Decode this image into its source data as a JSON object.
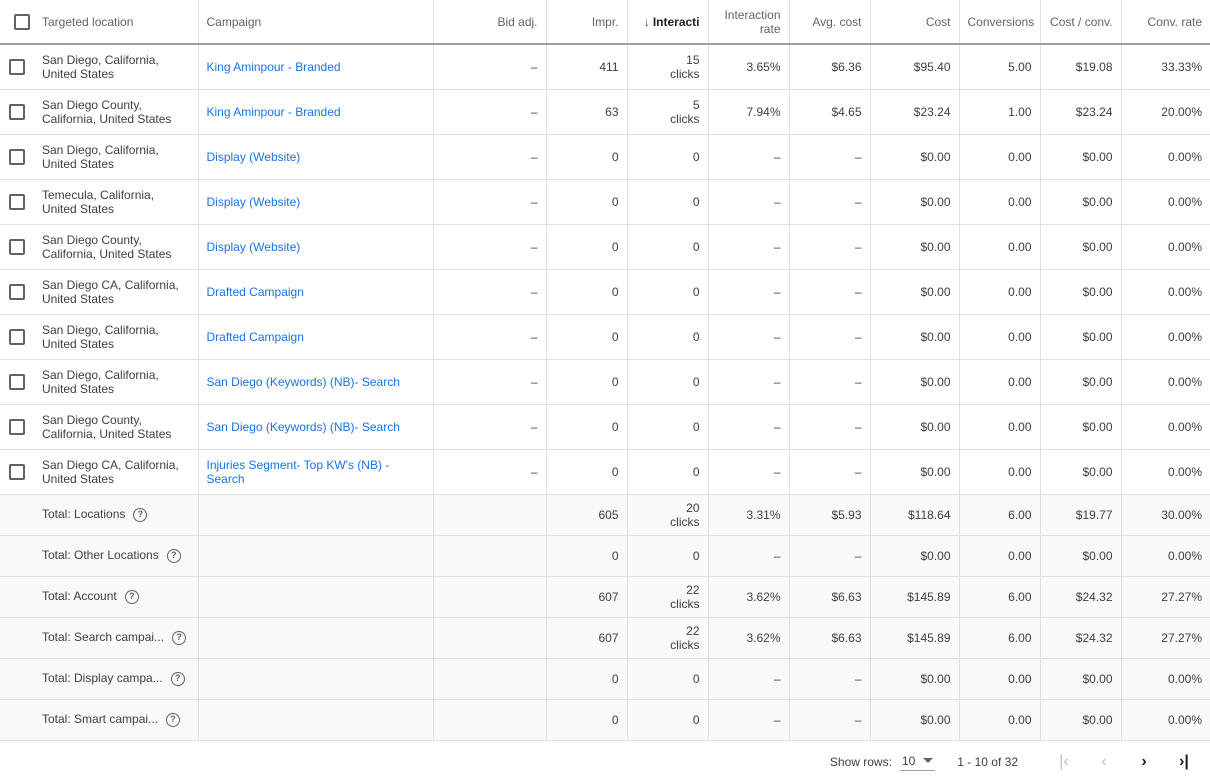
{
  "headers": {
    "location": "Targeted location",
    "campaign": "Campaign",
    "bid_adj": "Bid adj.",
    "impr": "Impr.",
    "interactions": "Interacti",
    "interaction_rate": "Interaction rate",
    "avg_cost": "Avg. cost",
    "cost": "Cost",
    "conversions": "Conversions",
    "cost_conv": "Cost / conv.",
    "conv_rate": "Conv. rate"
  },
  "rows": [
    {
      "location": "San Diego, California, United States",
      "campaign": "King Aminpour - Branded",
      "bid_adj": "–",
      "impr": "411",
      "interactions": "15",
      "interactions_unit": "clicks",
      "interaction_rate": "3.65%",
      "avg_cost": "$6.36",
      "cost": "$95.40",
      "conversions": "5.00",
      "cost_conv": "$19.08",
      "conv_rate": "33.33%"
    },
    {
      "location": "San Diego County, California, United States",
      "campaign": "King Aminpour - Branded",
      "bid_adj": "–",
      "impr": "63",
      "interactions": "5",
      "interactions_unit": "clicks",
      "interaction_rate": "7.94%",
      "avg_cost": "$4.65",
      "cost": "$23.24",
      "conversions": "1.00",
      "cost_conv": "$23.24",
      "conv_rate": "20.00%"
    },
    {
      "location": "San Diego, California, United States",
      "campaign": "Display (Website)",
      "bid_adj": "–",
      "impr": "0",
      "interactions": "0",
      "interactions_unit": "",
      "interaction_rate": "–",
      "avg_cost": "–",
      "cost": "$0.00",
      "conversions": "0.00",
      "cost_conv": "$0.00",
      "conv_rate": "0.00%"
    },
    {
      "location": "Temecula, California, United States",
      "campaign": "Display (Website)",
      "bid_adj": "–",
      "impr": "0",
      "interactions": "0",
      "interactions_unit": "",
      "interaction_rate": "–",
      "avg_cost": "–",
      "cost": "$0.00",
      "conversions": "0.00",
      "cost_conv": "$0.00",
      "conv_rate": "0.00%"
    },
    {
      "location": "San Diego County, California, United States",
      "campaign": "Display (Website)",
      "bid_adj": "–",
      "impr": "0",
      "interactions": "0",
      "interactions_unit": "",
      "interaction_rate": "–",
      "avg_cost": "–",
      "cost": "$0.00",
      "conversions": "0.00",
      "cost_conv": "$0.00",
      "conv_rate": "0.00%"
    },
    {
      "location": "San Diego CA, California, United States",
      "campaign": "Drafted Campaign",
      "bid_adj": "–",
      "impr": "0",
      "interactions": "0",
      "interactions_unit": "",
      "interaction_rate": "–",
      "avg_cost": "–",
      "cost": "$0.00",
      "conversions": "0.00",
      "cost_conv": "$0.00",
      "conv_rate": "0.00%"
    },
    {
      "location": "San Diego, California, United States",
      "campaign": "Drafted Campaign",
      "bid_adj": "–",
      "impr": "0",
      "interactions": "0",
      "interactions_unit": "",
      "interaction_rate": "–",
      "avg_cost": "–",
      "cost": "$0.00",
      "conversions": "0.00",
      "cost_conv": "$0.00",
      "conv_rate": "0.00%"
    },
    {
      "location": "San Diego, California, United States",
      "campaign": "San Diego (Keywords) (NB)- Search",
      "bid_adj": "–",
      "impr": "0",
      "interactions": "0",
      "interactions_unit": "",
      "interaction_rate": "–",
      "avg_cost": "–",
      "cost": "$0.00",
      "conversions": "0.00",
      "cost_conv": "$0.00",
      "conv_rate": "0.00%"
    },
    {
      "location": "San Diego County, California, United States",
      "campaign": "San Diego (Keywords) (NB)- Search",
      "bid_adj": "–",
      "impr": "0",
      "interactions": "0",
      "interactions_unit": "",
      "interaction_rate": "–",
      "avg_cost": "–",
      "cost": "$0.00",
      "conversions": "0.00",
      "cost_conv": "$0.00",
      "conv_rate": "0.00%"
    },
    {
      "location": "San Diego CA, California, United States",
      "campaign": "Injuries Segment- Top KW's (NB) - Search",
      "bid_adj": "–",
      "impr": "0",
      "interactions": "0",
      "interactions_unit": "",
      "interaction_rate": "–",
      "avg_cost": "–",
      "cost": "$0.00",
      "conversions": "0.00",
      "cost_conv": "$0.00",
      "conv_rate": "0.00%"
    }
  ],
  "totals": [
    {
      "label": "Total: Locations",
      "impr": "605",
      "interactions": "20",
      "interactions_unit": "clicks",
      "interaction_rate": "3.31%",
      "avg_cost": "$5.93",
      "cost": "$118.64",
      "conversions": "6.00",
      "cost_conv": "$19.77",
      "conv_rate": "30.00%"
    },
    {
      "label": "Total: Other Locations",
      "impr": "0",
      "interactions": "0",
      "interactions_unit": "",
      "interaction_rate": "–",
      "avg_cost": "–",
      "cost": "$0.00",
      "conversions": "0.00",
      "cost_conv": "$0.00",
      "conv_rate": "0.00%"
    },
    {
      "label": "Total: Account",
      "impr": "607",
      "interactions": "22",
      "interactions_unit": "clicks",
      "interaction_rate": "3.62%",
      "avg_cost": "$6.63",
      "cost": "$145.89",
      "conversions": "6.00",
      "cost_conv": "$24.32",
      "conv_rate": "27.27%"
    },
    {
      "label": "Total: Search campai...",
      "impr": "607",
      "interactions": "22",
      "interactions_unit": "clicks",
      "interaction_rate": "3.62%",
      "avg_cost": "$6.63",
      "cost": "$145.89",
      "conversions": "6.00",
      "cost_conv": "$24.32",
      "conv_rate": "27.27%"
    },
    {
      "label": "Total: Display campa...",
      "impr": "0",
      "interactions": "0",
      "interactions_unit": "",
      "interaction_rate": "–",
      "avg_cost": "–",
      "cost": "$0.00",
      "conversions": "0.00",
      "cost_conv": "$0.00",
      "conv_rate": "0.00%"
    },
    {
      "label": "Total: Smart campai...",
      "impr": "0",
      "interactions": "0",
      "interactions_unit": "",
      "interaction_rate": "–",
      "avg_cost": "–",
      "cost": "$0.00",
      "conversions": "0.00",
      "cost_conv": "$0.00",
      "conv_rate": "0.00%"
    }
  ],
  "pagination": {
    "show_rows_label": "Show rows:",
    "rows_value": "10",
    "range": "1 - 10 of 32"
  },
  "icons": {
    "sort": "arrow-down-icon",
    "help": "help-circle-icon",
    "first_page": "first-page-icon",
    "prev_page": "chevron-left-icon",
    "next_page": "chevron-right-icon",
    "last_page": "last-page-icon"
  },
  "colors": {
    "link": "#1a73e8",
    "text": "#3c4043",
    "header_text": "#5f6368",
    "total_bg": "#f8f9fa",
    "border": "#e0e0e0"
  }
}
